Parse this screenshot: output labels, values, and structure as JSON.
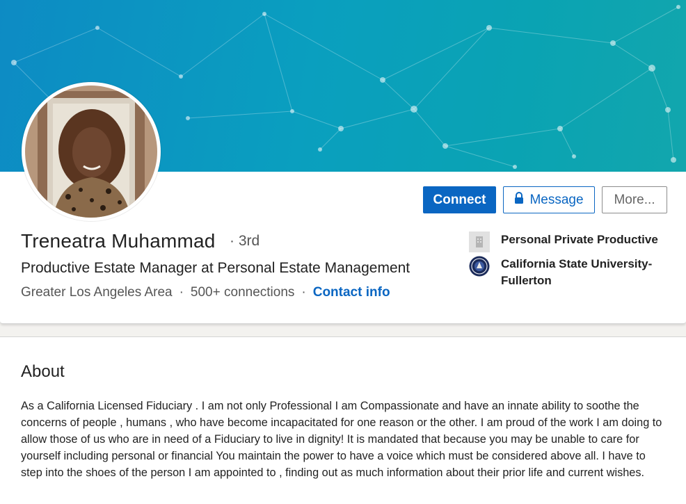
{
  "profile": {
    "name": "Treneatra Muhammad",
    "degree": "· 3rd",
    "headline": "Productive Estate Manager at Personal Estate Management",
    "location": "Greater Los Angeles Area",
    "connections": "500+ connections",
    "contact_info": "Contact info",
    "separator": "·"
  },
  "actions": {
    "connect": "Connect",
    "message": "Message",
    "more": "More..."
  },
  "sidebar": {
    "company": "Personal Private Productive",
    "school": "California State University-Fullerton"
  },
  "about": {
    "title": "About",
    "text": "As a California Licensed Fiduciary . I am not only Professional I am Compassionate and have an innate ability to soothe the concerns of people , humans , who have become incapacitated for one reason or the other. I am proud of the work I am doing to allow those of us who are in need of a Fiduciary to live in dignity! It is mandated that because you may be unable to care for yourself including personal or financial You maintain the power to have a voice which must be considered above all. I have to step into the shoes of the person I am appointed to , finding out as much information about their prior life and current wishes."
  },
  "colors": {
    "accent": "#0a66c2",
    "banner": "#0aa0bf"
  },
  "icons": {
    "lock": "lock-icon",
    "company_logo": "company-logo-icon",
    "school_logo": "school-seal-icon"
  }
}
